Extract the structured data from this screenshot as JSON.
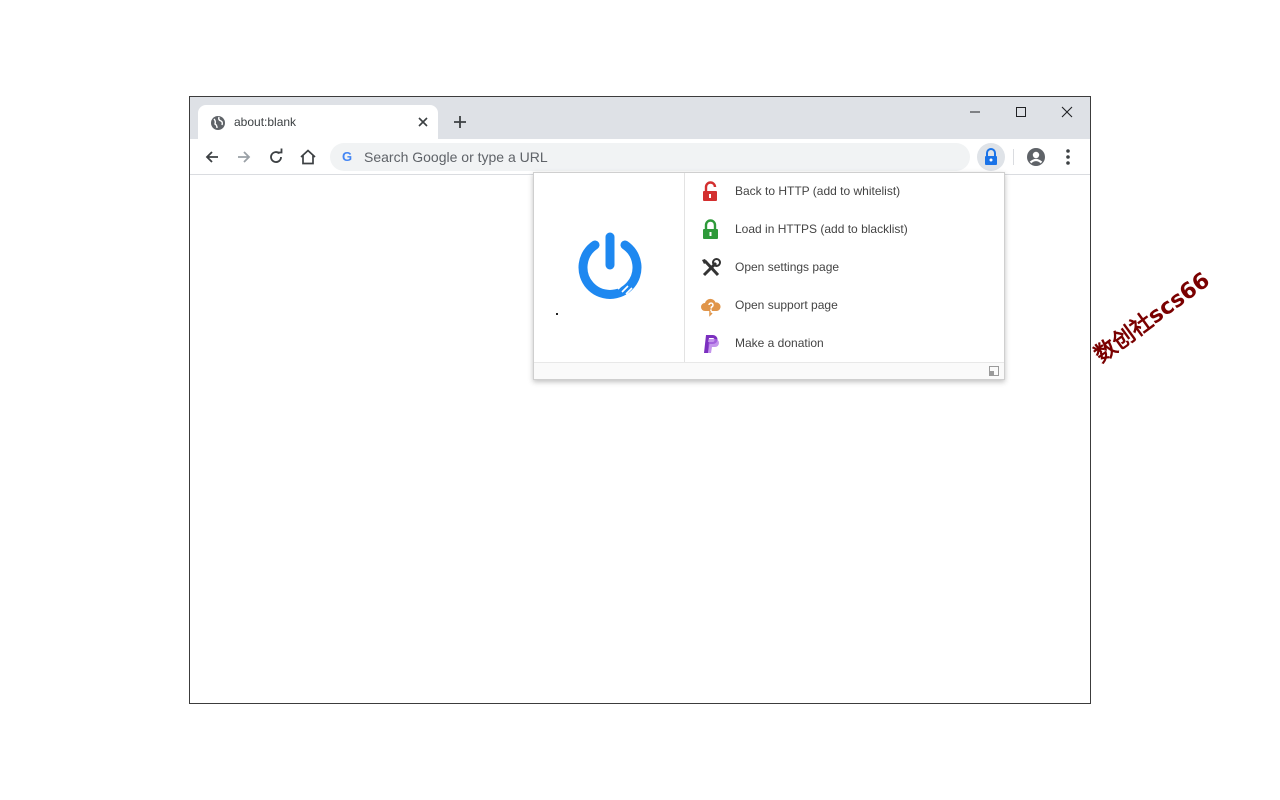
{
  "tab": {
    "title": "about:blank",
    "favicon": "globe-icon"
  },
  "titlebar": {
    "new_tab_icon": "plus-icon",
    "minimize_icon": "minimize-icon",
    "maximize_icon": "maximize-icon",
    "close_icon": "close-icon"
  },
  "toolbar": {
    "back_icon": "arrow-left-icon",
    "forward_icon": "arrow-right-icon",
    "reload_icon": "reload-icon",
    "home_icon": "home-icon",
    "omnibox_logo": "G",
    "omnibox_placeholder": "Search Google or type a URL",
    "extension_icon": "lock-icon",
    "profile_icon": "account-icon",
    "menu_icon": "more-vert-icon"
  },
  "popup": {
    "logo_icon": "power-icon",
    "items": [
      {
        "label": "Back to HTTP (add to whitelist)",
        "icon": "unlocked-icon",
        "color": "#d32f2f"
      },
      {
        "label": "Load in HTTPS (add to blacklist)",
        "icon": "locked-icon",
        "color": "#2e9a3a"
      },
      {
        "label": "Open settings page",
        "icon": "tools-icon",
        "color": "#333333"
      },
      {
        "label": "Open support page",
        "icon": "cloud-question-icon",
        "color": "#e0954a"
      },
      {
        "label": "Make a donation",
        "icon": "paypal-icon",
        "color": "#7b2fbf"
      }
    ]
  },
  "watermark": "数创社scs66",
  "colors": {
    "accent_blue": "#1a73e8",
    "power_blue": "#1e88f0",
    "titlebar_bg": "#dee1e6",
    "omnibox_bg": "#f1f3f4"
  }
}
